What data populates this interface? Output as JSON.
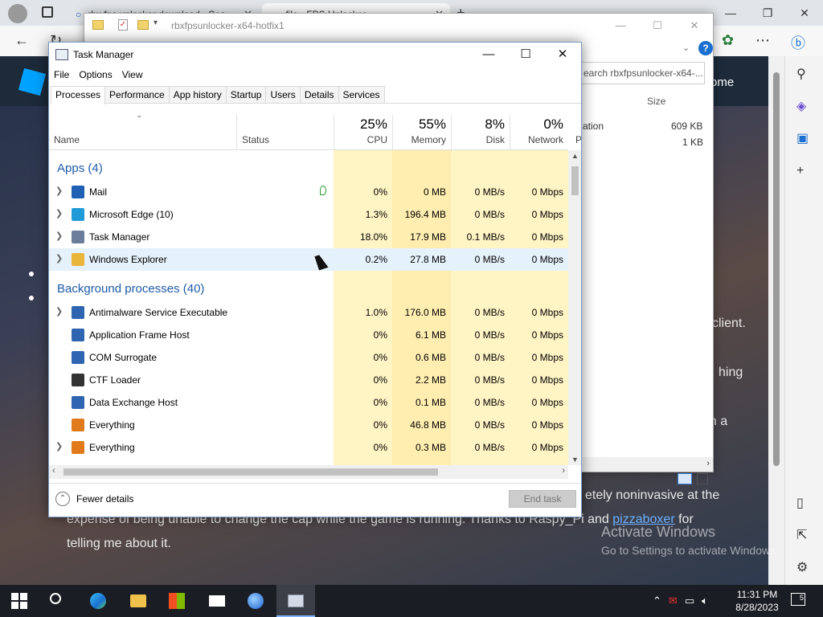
{
  "browser": {
    "tabs": [
      {
        "title": "rbx fps unlocker download - Sea"
      },
      {
        "title": "file - FPS Unlocker"
      }
    ],
    "page": {
      "home_label": "ome",
      "text_client": "client.",
      "text_hing": "hing",
      "text_en_a": "en a",
      "line1": "etely noninvasive at the",
      "line2_a": "expense of being unable to change the cap while the game is running. Thanks to Raspy_Pi and ",
      "line2_link": "pizzaboxer",
      "line2_b": " for",
      "line3": "telling me about it."
    },
    "watermark": {
      "title": "Activate Windows",
      "subtitle": "Go to Settings to activate Windows."
    }
  },
  "explorer": {
    "title": "rbxfpsunlocker-x64-hotfix1",
    "search_placeholder": "earch rbxfpsunlocker-x64-...",
    "size_header": "Size",
    "col_partial": "ation",
    "size1": "609 KB",
    "size2": "1 KB"
  },
  "taskmanager": {
    "title": "Task Manager",
    "menu": [
      "File",
      "Options",
      "View"
    ],
    "tabs": [
      "Processes",
      "Performance",
      "App history",
      "Startup",
      "Users",
      "Details",
      "Services"
    ],
    "columns": {
      "name": "Name",
      "status": "Status",
      "cpu": {
        "pct": "25%",
        "label": "CPU"
      },
      "memory": {
        "pct": "55%",
        "label": "Memory"
      },
      "disk": {
        "pct": "8%",
        "label": "Disk"
      },
      "network": {
        "pct": "0%",
        "label": "Network"
      },
      "power_partial": "P"
    },
    "groups": {
      "apps": "Apps (4)",
      "background": "Background processes (40)"
    },
    "apps": [
      {
        "name": "Mail",
        "cpu": "0%",
        "memory": "0 MB",
        "disk": "0 MB/s",
        "network": "0 Mbps",
        "icon": "mail-icon",
        "color": "#1f5fb4"
      },
      {
        "name": "Microsoft Edge (10)",
        "cpu": "1.3%",
        "memory": "196.4 MB",
        "disk": "0 MB/s",
        "network": "0 Mbps",
        "icon": "edge-icon",
        "color": "#1f9bd8"
      },
      {
        "name": "Task Manager",
        "cpu": "18.0%",
        "memory": "17.9 MB",
        "disk": "0.1 MB/s",
        "network": "0 Mbps",
        "icon": "task-manager-icon",
        "color": "#6b7d9a"
      },
      {
        "name": "Windows Explorer",
        "cpu": "0.2%",
        "memory": "27.8 MB",
        "disk": "0 MB/s",
        "network": "0 Mbps",
        "icon": "folder-icon",
        "color": "#e9b63a"
      }
    ],
    "background": [
      {
        "name": "Antimalware Service Executable",
        "cpu": "1.0%",
        "memory": "176.0 MB",
        "disk": "0 MB/s",
        "network": "0 Mbps",
        "icon": "service-icon",
        "color": "#2e64b0"
      },
      {
        "name": "Application Frame Host",
        "cpu": "0%",
        "memory": "6.1 MB",
        "disk": "0 MB/s",
        "network": "0 Mbps",
        "icon": "service-icon",
        "color": "#2e64b0"
      },
      {
        "name": "COM Surrogate",
        "cpu": "0%",
        "memory": "0.6 MB",
        "disk": "0 MB/s",
        "network": "0 Mbps",
        "icon": "service-icon",
        "color": "#2e64b0"
      },
      {
        "name": "CTF Loader",
        "cpu": "0%",
        "memory": "2.2 MB",
        "disk": "0 MB/s",
        "network": "0 Mbps",
        "icon": "ctf-icon",
        "color": "#333333"
      },
      {
        "name": "Data Exchange Host",
        "cpu": "0%",
        "memory": "0.1 MB",
        "disk": "0 MB/s",
        "network": "0 Mbps",
        "icon": "service-icon",
        "color": "#2e64b0"
      },
      {
        "name": "Everything",
        "cpu": "0%",
        "memory": "46.8 MB",
        "disk": "0 MB/s",
        "network": "0 Mbps",
        "icon": "magnifier-icon",
        "color": "#e07a1a"
      },
      {
        "name": "Everything",
        "cpu": "0%",
        "memory": "0.3 MB",
        "disk": "0 MB/s",
        "network": "0 Mbps",
        "icon": "magnifier-icon",
        "color": "#e07a1a"
      }
    ],
    "footer": {
      "fewer_details": "Fewer details",
      "end_task": "End task"
    }
  },
  "taskbar": {
    "clock_time": "11:31 PM",
    "clock_date": "8/28/2023",
    "notifications": "5"
  }
}
